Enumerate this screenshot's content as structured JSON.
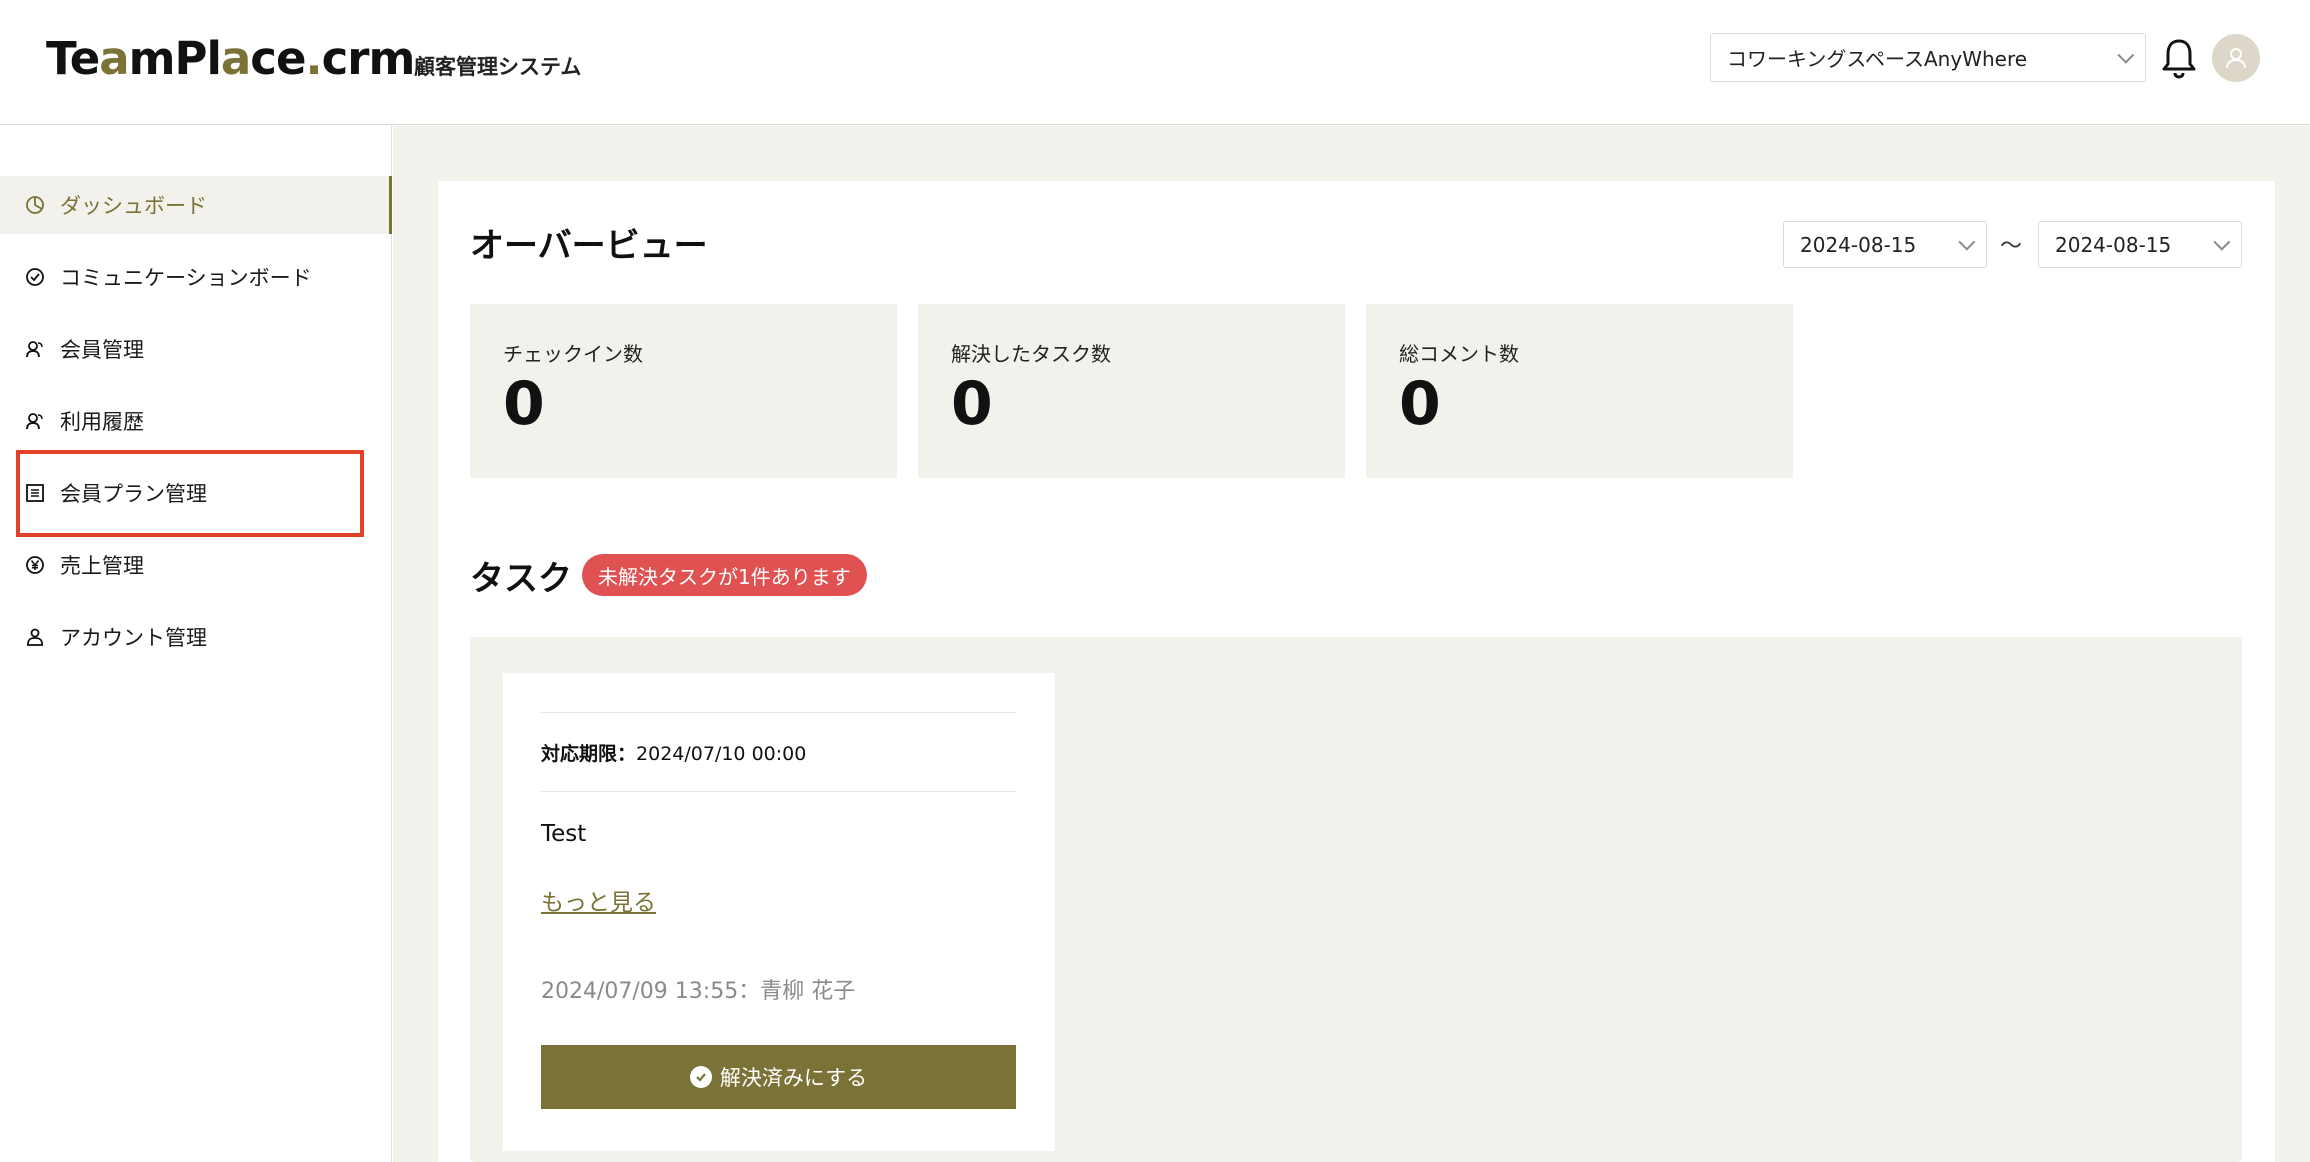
{
  "header": {
    "logo": {
      "part1": "Te",
      "part2": "a",
      "part3": "mPl",
      "part4": "a",
      "part5": "ce",
      "part6": ".",
      "part7": "crm"
    },
    "subtitle": "顧客管理システム",
    "space_select": "コワーキングスペースAnyWhere",
    "notification_icon": "bell-icon",
    "avatar_icon": "user-icon"
  },
  "sidebar": {
    "items": [
      {
        "label": "ダッシュボード",
        "icon": "pie-chart-icon",
        "active": true
      },
      {
        "label": "コミュニケーションボード",
        "icon": "check-circle-icon",
        "active": false
      },
      {
        "label": "会員管理",
        "icon": "users-icon",
        "active": false
      },
      {
        "label": "利用履歴",
        "icon": "users-icon",
        "active": false
      },
      {
        "label": "会員プラン管理",
        "icon": "list-icon",
        "active": false,
        "highlighted": true
      },
      {
        "label": "売上管理",
        "icon": "yen-circle-icon",
        "active": false
      },
      {
        "label": "アカウント管理",
        "icon": "account-icon",
        "active": false
      }
    ]
  },
  "overview": {
    "title": "オーバービュー",
    "date_from": "2024-08-15",
    "tilde": "〜",
    "date_to": "2024-08-15",
    "stats": [
      {
        "label": "チェックイン数",
        "value": "0"
      },
      {
        "label": "解決したタスク数",
        "value": "0"
      },
      {
        "label": "総コメント数",
        "value": "0"
      }
    ]
  },
  "tasks": {
    "title": "タスク",
    "badge": "未解決タスクが1件あります",
    "cards": [
      {
        "deadline_label": "対応期限：",
        "deadline_value": "2024/07/10 00:00",
        "text": "Test",
        "more_link": "もっと見る",
        "meta": "2024/07/09 13:55：青柳 花子",
        "resolve_button": "解決済みにする"
      }
    ]
  },
  "colors": {
    "accent": "#7b7237",
    "background": "#f2f1ec",
    "badge": "#e05252",
    "highlight": "#e2412a"
  }
}
